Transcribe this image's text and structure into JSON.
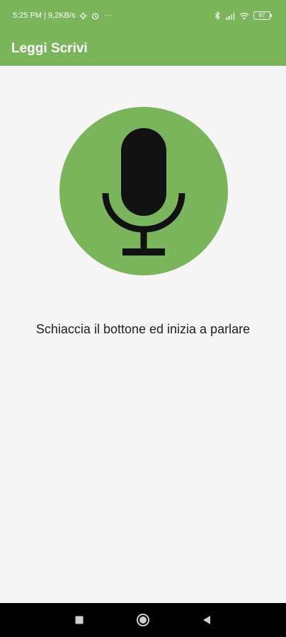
{
  "status_bar": {
    "time_speed": "5:25 PM | 9,2KB/s",
    "more_indicator": "···",
    "battery": "97"
  },
  "app": {
    "title": "Leggi Scrivi"
  },
  "main": {
    "mic_button_icon": "microphone-icon",
    "prompt": "Schiaccia il bottone ed inizia a parlare"
  },
  "nav": {
    "recents_icon": "square-icon",
    "home_icon": "circle-icon",
    "back_icon": "triangle-back-icon"
  },
  "colors": {
    "accent": "#7ab55c",
    "background": "#f5f5f5",
    "nav_bar": "#000000"
  }
}
